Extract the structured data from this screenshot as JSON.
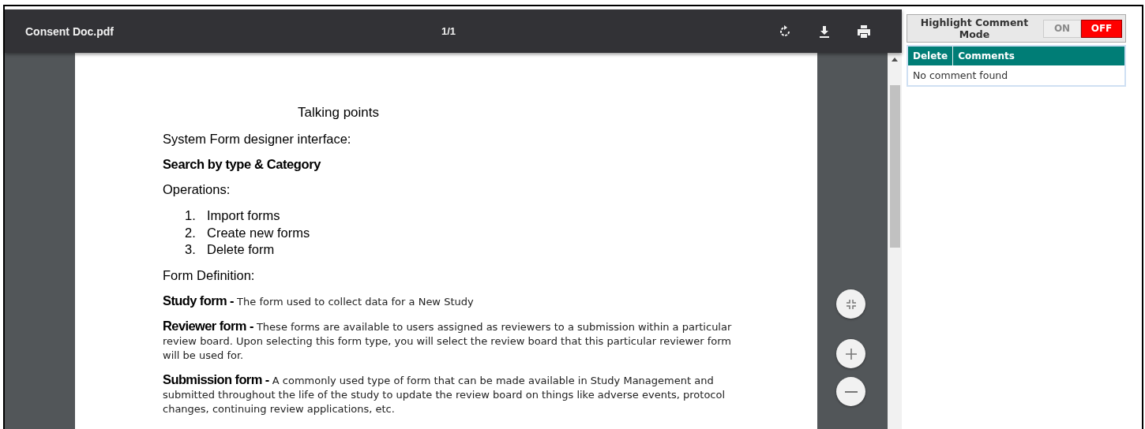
{
  "viewer": {
    "file_name": "Consent Doc.pdf",
    "page_counter": "1/1"
  },
  "document": {
    "title": "Talking points",
    "intro": "System Form designer interface:",
    "heading": "Search by type & Category",
    "operations_label": "Operations:",
    "operations": [
      {
        "number": "1.",
        "text": "Import forms"
      },
      {
        "number": "2.",
        "text": "Create new forms"
      },
      {
        "number": "3.",
        "text": "Delete form"
      }
    ],
    "definition_label": "Form Definition:",
    "definitions": [
      {
        "term": "Study form -",
        "text": "The form used to collect data for a New Study"
      },
      {
        "term": "Reviewer form -",
        "text": "These forms are available to users assigned as reviewers to a submission within a particular review board. Upon selecting this form type, you will select the review board that this particular reviewer form will be used for."
      },
      {
        "term": "Submission form -",
        "text": "A commonly used type of form that can be made available in Study Management and submitted throughout the life of the study to update the review board on things like adverse events, protocol changes, continuing review applications, etc."
      }
    ]
  },
  "comments_panel": {
    "mode_label": "Highlight Comment Mode",
    "toggle": [
      {
        "label": "ON",
        "selected": false
      },
      {
        "label": "OFF",
        "selected": true
      }
    ],
    "columns": [
      "Delete",
      "Comments"
    ],
    "empty_message": "No comment found"
  }
}
